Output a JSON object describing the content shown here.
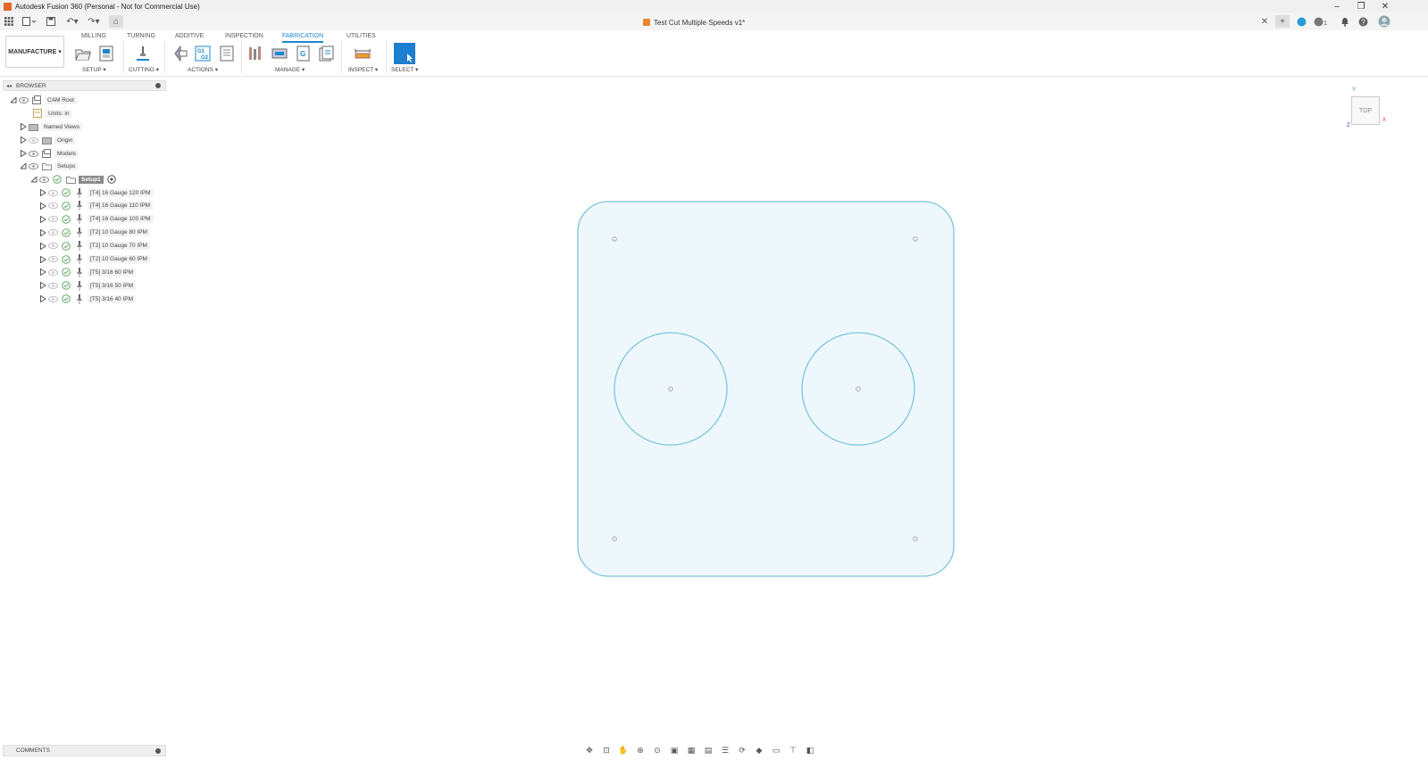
{
  "window": {
    "title": "Autodesk Fusion 360 (Personal - Not for Commercial Use)",
    "minimize_icon": "minimize-icon",
    "restore_icon": "restore-icon",
    "close_icon": "close-icon"
  },
  "document": {
    "tab_title": "Test Cut Multiple Speeds v1*"
  },
  "ribbon": {
    "workspace": "MANUFACTURE ▾",
    "tabs": [
      "MILLING",
      "TURNING",
      "ADDITIVE",
      "INSPECTION",
      "FABRICATION",
      "UTILITIES"
    ],
    "active_tab": "FABRICATION",
    "groups": {
      "setup": "SETUP ▾",
      "cutting": "CUTTING ▾",
      "actions": "ACTIONS ▾",
      "manage": "MANAGE ▾",
      "inspect": "INSPECT ▾",
      "select": "SELECT ▾"
    },
    "actions_g1": "G1",
    "actions_g2": "G2"
  },
  "browser": {
    "title": "BROWSER",
    "root": "CAM Root",
    "units": "Units: in",
    "named_views": "Named Views",
    "origin": "Origin",
    "models": "Models",
    "setups": "Setups",
    "setup1": "Setup1",
    "operations": [
      "[T4] 16 Gauge 120 IPM",
      "[T4] 16 Gauge 110 IPM",
      "[T4] 16 Gauge 100 IPM",
      "[T2] 10 Gauge 80 IPM",
      "[T2] 10 Gauge 70 IPM",
      "[T2] 10 Gauge 60 IPM",
      "[T5] 3/16 60 IPM",
      "[T5] 3/16 50 IPM",
      "[T5] 3/16 40 IPM"
    ]
  },
  "viewcube": {
    "face": "TOP",
    "axis_x": "X",
    "axis_y": "Y",
    "axis_z": "Z"
  },
  "comments": {
    "title": "COMMENTS"
  },
  "colors": {
    "accent": "#1e88d0",
    "part_fill": "#eef8fc",
    "part_stroke": "#7cc4dc"
  }
}
